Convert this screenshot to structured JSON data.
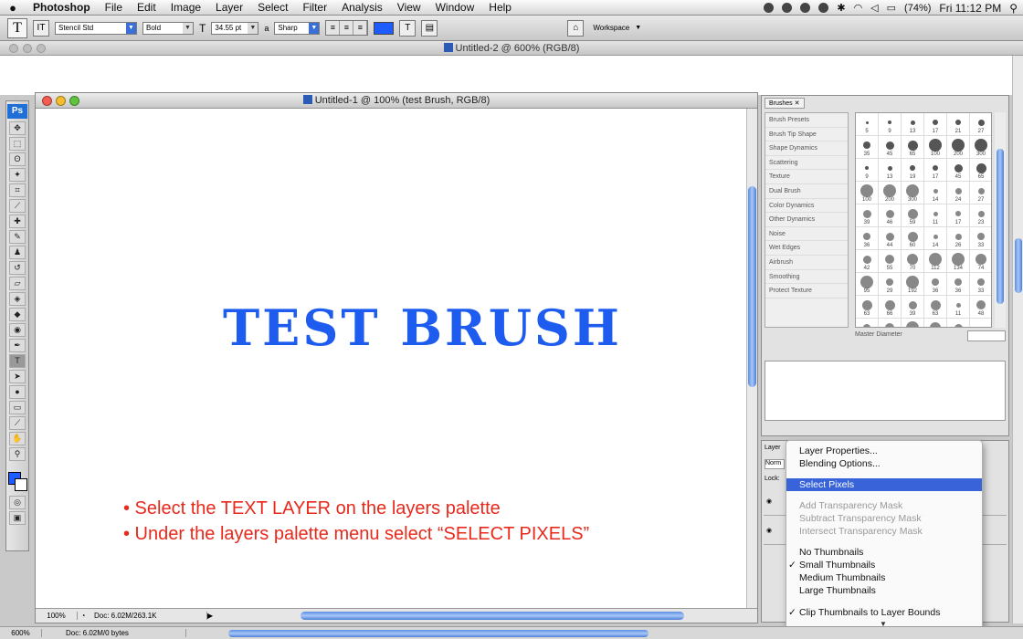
{
  "menubar": {
    "app": "Photoshop",
    "items": [
      "File",
      "Edit",
      "Image",
      "Layer",
      "Select",
      "Filter",
      "Analysis",
      "View",
      "Window",
      "Help"
    ],
    "battery": "(74%)",
    "clock": "Fri 11:12 PM"
  },
  "options": {
    "font_family": "Stencil Std",
    "font_style": "Bold",
    "font_size": "34.55 pt",
    "antialias": "Sharp",
    "workspace": "Workspace",
    "text_color": "#1f5cff"
  },
  "doc2": {
    "title": "Untitled-2 @ 600% (RGB/8)"
  },
  "document": {
    "title": "Untitled-1 @ 100% (test Brush, RGB/8)",
    "heading": "TEST BRUSH",
    "heading_color": "#1e5cf0",
    "bullet1": "• Select the TEXT LAYER on the layers palette",
    "bullet2": "• Under the layers palette menu select “SELECT PIXELS”",
    "bullet_color": "#e8291c",
    "zoom": "100%",
    "doc_info": "Doc: 6.02M/263.1K"
  },
  "brushes": {
    "tab": "Brushes",
    "options": [
      "Brush Presets",
      "Brush Tip Shape",
      "Shape Dynamics",
      "Scattering",
      "Texture",
      "Dual Brush",
      "Color Dynamics",
      "Other Dynamics",
      "Noise",
      "Wet Edges",
      "Airbrush",
      "Smoothing",
      "Protect Texture"
    ],
    "sizes": [
      "5",
      "9",
      "13",
      "17",
      "21",
      "27",
      "35",
      "45",
      "65",
      "100",
      "200",
      "300",
      "9",
      "13",
      "19",
      "17",
      "45",
      "65",
      "100",
      "200",
      "300",
      "14",
      "24",
      "27",
      "39",
      "46",
      "59",
      "11",
      "17",
      "23",
      "36",
      "44",
      "60",
      "14",
      "26",
      "33",
      "42",
      "55",
      "70",
      "112",
      "134",
      "74",
      "95",
      "29",
      "192",
      "36",
      "36",
      "33",
      "63",
      "66",
      "39",
      "63",
      "11",
      "48",
      "32",
      "55",
      "100",
      "75",
      "45",
      ""
    ],
    "master_diameter": "Master Diameter"
  },
  "layers": {
    "tab": "Layer",
    "mode": "Norm",
    "lock": "Lock:"
  },
  "context_menu": {
    "items": [
      {
        "label": "Layer Properties...",
        "state": "normal"
      },
      {
        "label": "Blending Options...",
        "state": "normal"
      },
      {
        "label": "Select Pixels",
        "state": "selected"
      },
      {
        "label": "Add Transparency Mask",
        "state": "disabled"
      },
      {
        "label": "Subtract Transparency Mask",
        "state": "disabled"
      },
      {
        "label": "Intersect Transparency Mask",
        "state": "disabled"
      },
      {
        "label": "No Thumbnails",
        "state": "normal"
      },
      {
        "label": "Small Thumbnails",
        "state": "checked"
      },
      {
        "label": "Medium Thumbnails",
        "state": "normal"
      },
      {
        "label": "Large Thumbnails",
        "state": "normal"
      },
      {
        "label": "Clip Thumbnails to Layer Bounds",
        "state": "checked"
      }
    ]
  },
  "app_status": {
    "zoom": "600%",
    "doc_info": "Doc: 6.02M/0 bytes"
  }
}
